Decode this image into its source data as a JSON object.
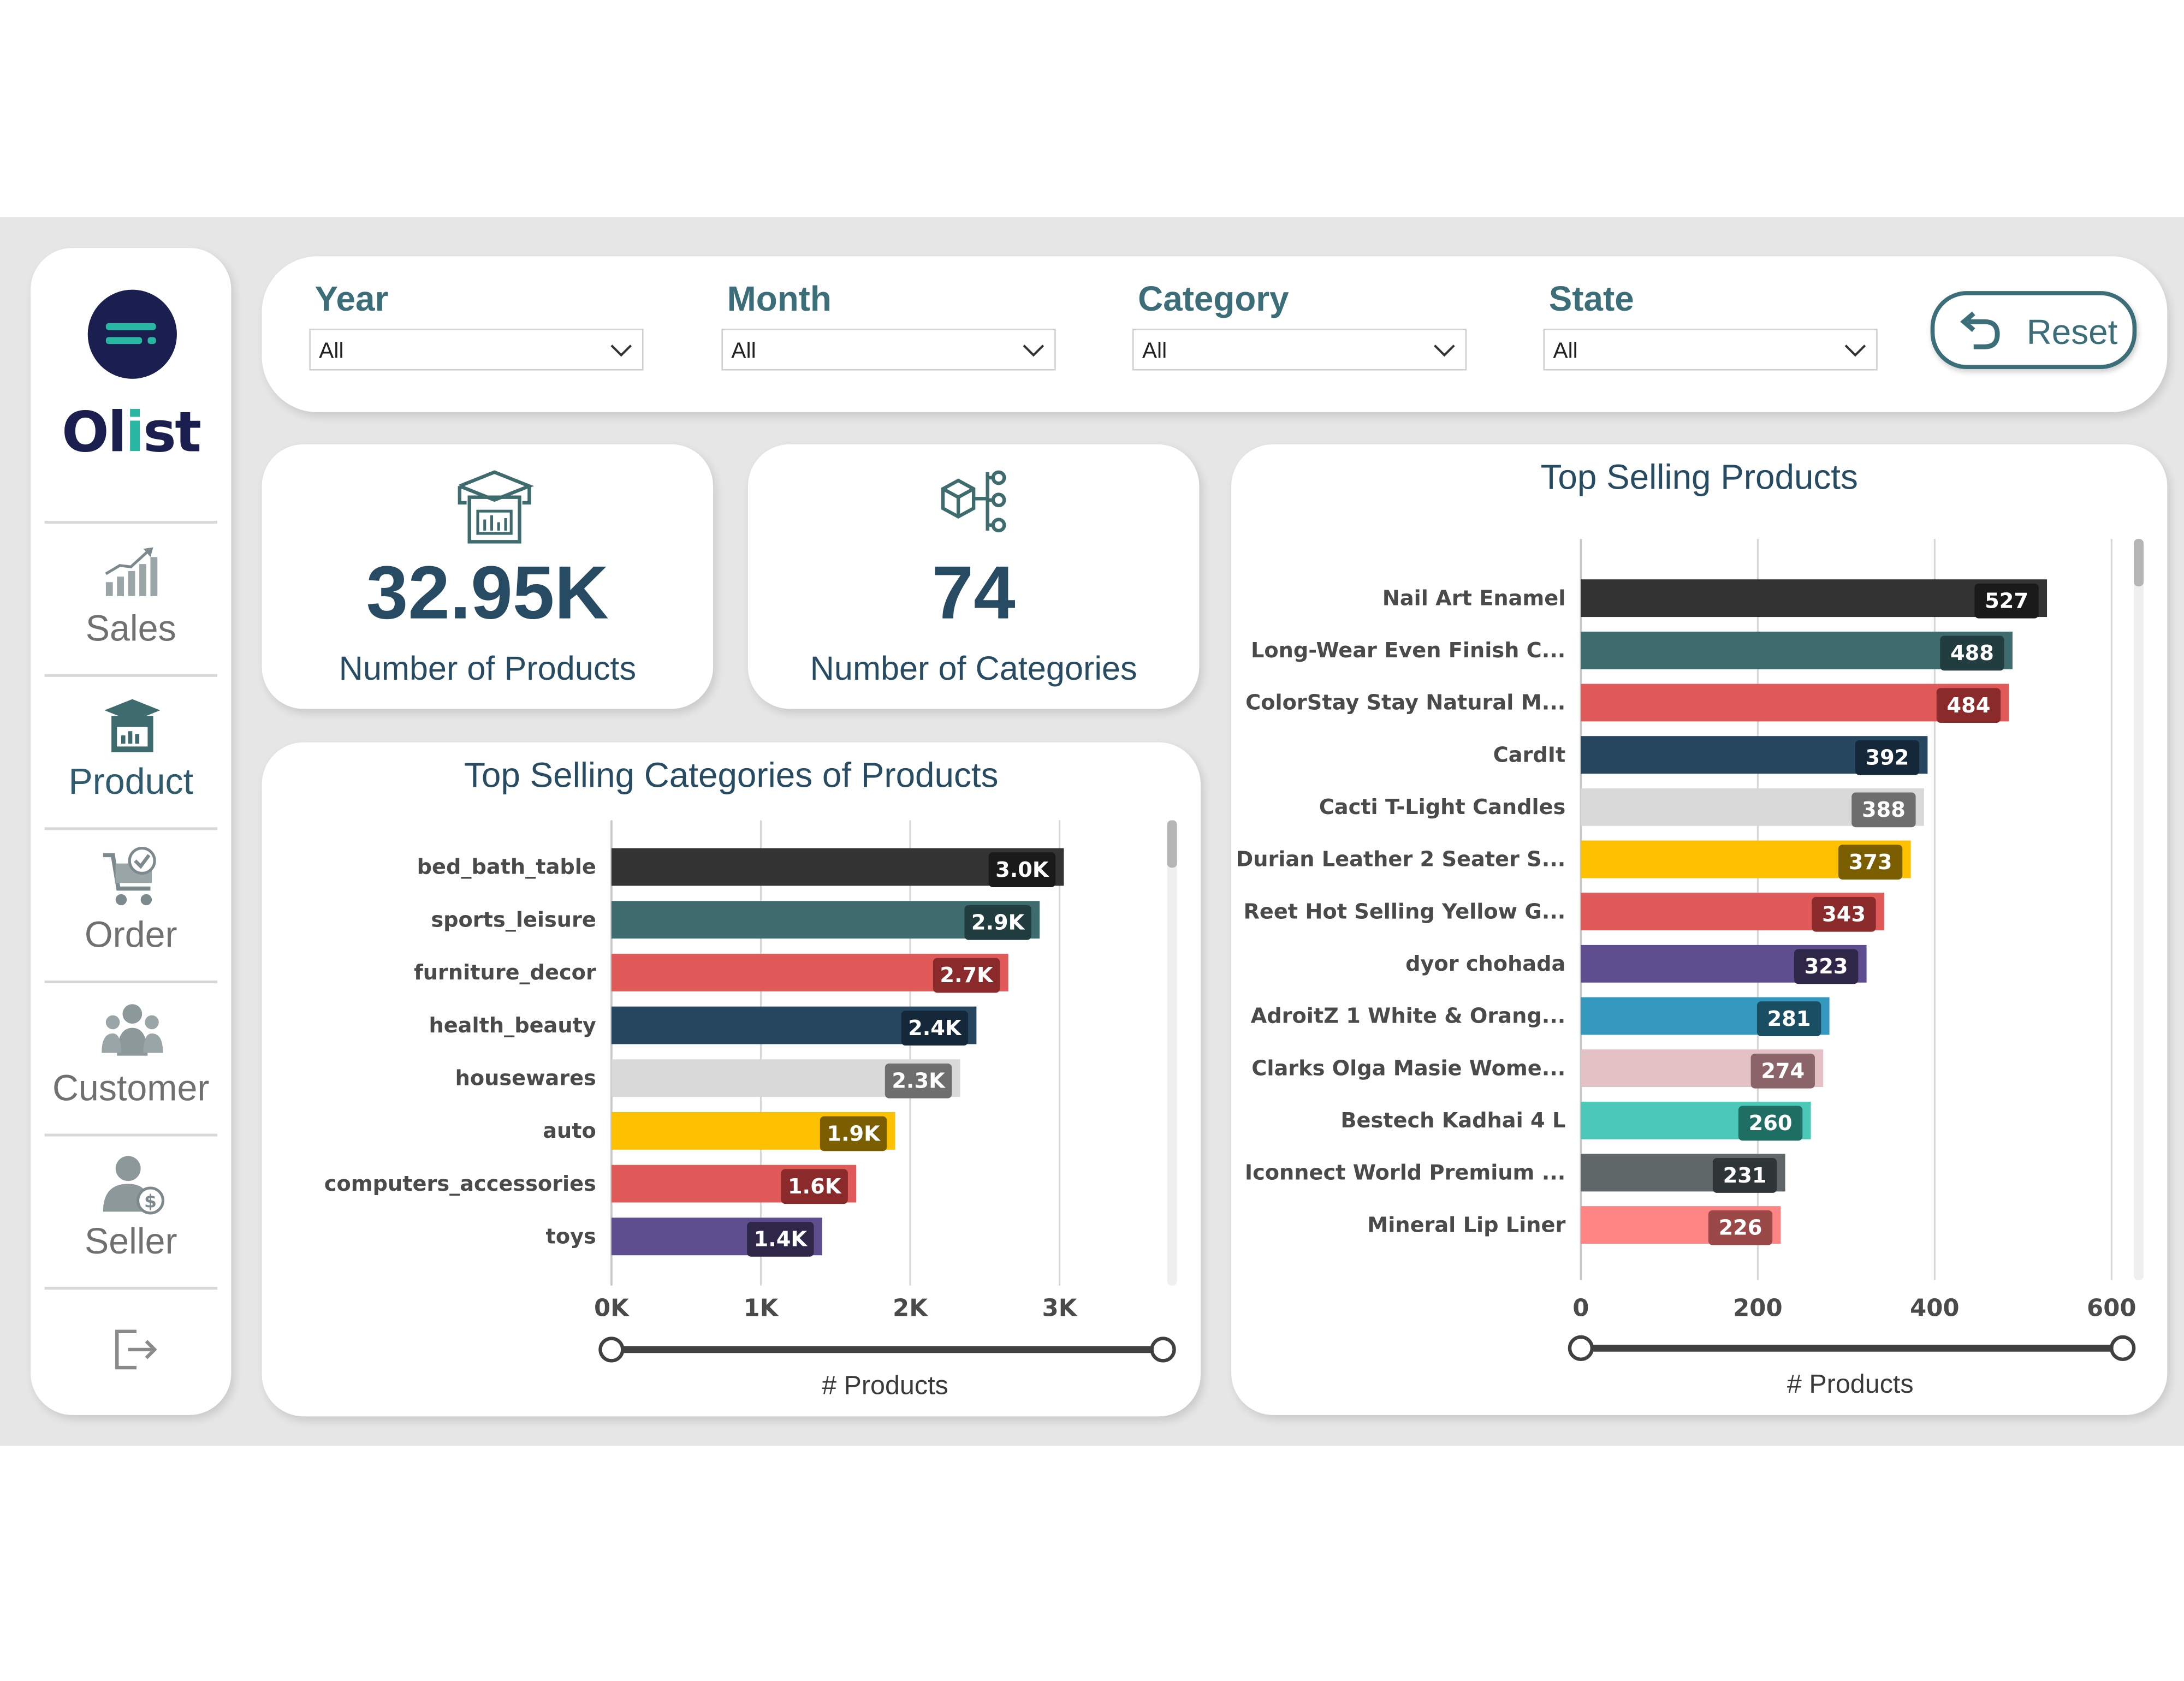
{
  "brand": {
    "name_prefix": "Ol",
    "name_mid": "i",
    "name_suffix": "st",
    "accent": "#27b7a3",
    "dark": "#1b1f4f"
  },
  "nav": {
    "items": [
      {
        "label": "Sales",
        "icon": "sales-chart-icon",
        "active": false
      },
      {
        "label": "Product",
        "icon": "product-box-icon",
        "active": true
      },
      {
        "label": "Order",
        "icon": "shopping-cart-check-icon",
        "active": false
      },
      {
        "label": "Customer",
        "icon": "customers-group-icon",
        "active": false
      },
      {
        "label": "Seller",
        "icon": "seller-dollar-icon",
        "active": false
      }
    ],
    "exit_icon": "exit-icon"
  },
  "filters": {
    "year": {
      "title": "Year",
      "value": "All"
    },
    "month": {
      "title": "Month",
      "value": "All"
    },
    "category": {
      "title": "Category",
      "value": "All"
    },
    "state": {
      "title": "State",
      "value": "All"
    },
    "reset_label": "Reset"
  },
  "kpis": {
    "products": {
      "value": "32.95K",
      "label": "Number of Products",
      "icon": "product-box-icon"
    },
    "categories": {
      "value": "74",
      "label": "Number of Categories",
      "icon": "category-tree-icon"
    }
  },
  "chart_data": [
    {
      "type": "bar",
      "orientation": "horizontal",
      "title": "Top Selling Categories of Products",
      "xlabel": "# Products",
      "categories": [
        "bed_bath_table",
        "sports_leisure",
        "furniture_decor",
        "health_beauty",
        "housewares",
        "auto",
        "computers_accessories",
        "toys"
      ],
      "values": [
        3029,
        2867,
        2657,
        2444,
        2335,
        1900,
        1639,
        1411
      ],
      "data_labels": [
        "3.0K",
        "2.9K",
        "2.7K",
        "2.4K",
        "2.3K",
        "1.9K",
        "1.6K",
        "1.4K"
      ],
      "colors": [
        "#333333",
        "#3d6b6e",
        "#e05a5a",
        "#27465f",
        "#d9d9d9",
        "#fdc100",
        "#e05a5a",
        "#5e4e8f"
      ],
      "label_bg": [
        "#1a1a1a",
        "#223d40",
        "#8a2a2a",
        "#15283a",
        "#6e6e6e",
        "#7a5e00",
        "#8a2a2a",
        "#2f2748"
      ],
      "xlim": [
        0,
        3600
      ],
      "xticks": [
        0,
        1000,
        2000,
        3000
      ],
      "xtick_labels": [
        "0K",
        "1K",
        "2K",
        "3K"
      ],
      "grid": true
    },
    {
      "type": "bar",
      "orientation": "horizontal",
      "title": "Top Selling Products",
      "xlabel": "# Products",
      "categories": [
        "Nail Art Enamel",
        "Long-Wear Even Finish C...",
        "ColorStay Stay Natural M...",
        "CardIt",
        "Cacti T-Light Candles",
        "Durian Leather 2 Seater S...",
        "Reet Hot Selling Yellow G...",
        "dyor chohada",
        "AdroitZ 1 White & Orang...",
        "Clarks Olga Masie Wome...",
        "Bestech Kadhai 4 L",
        "Iconnect World Premium ...",
        "Mineral Lip Liner"
      ],
      "values": [
        527,
        488,
        484,
        392,
        388,
        373,
        343,
        323,
        281,
        274,
        260,
        231,
        226
      ],
      "data_labels": [
        "527",
        "488",
        "484",
        "392",
        "388",
        "373",
        "343",
        "323",
        "281",
        "274",
        "260",
        "231",
        "226"
      ],
      "colors": [
        "#333333",
        "#3d6b6e",
        "#e05a5a",
        "#27465f",
        "#d9d9d9",
        "#fdc100",
        "#e05a5a",
        "#5e4e8f",
        "#3598be",
        "#e3c0c4",
        "#4cc8b8",
        "#5f6668",
        "#ff8585"
      ],
      "label_bg": [
        "#1a1a1a",
        "#223d40",
        "#8a2a2a",
        "#15283a",
        "#6e6e6e",
        "#7a5e00",
        "#8a2a2a",
        "#2f2748",
        "#1a4f63",
        "#8a6468",
        "#1f6e64",
        "#2f3436",
        "#9a4848"
      ],
      "xlim": [
        0,
        600
      ],
      "xticks": [
        0,
        200,
        400,
        600
      ],
      "xtick_labels": [
        "0",
        "200",
        "400",
        "600"
      ],
      "grid": true
    }
  ]
}
